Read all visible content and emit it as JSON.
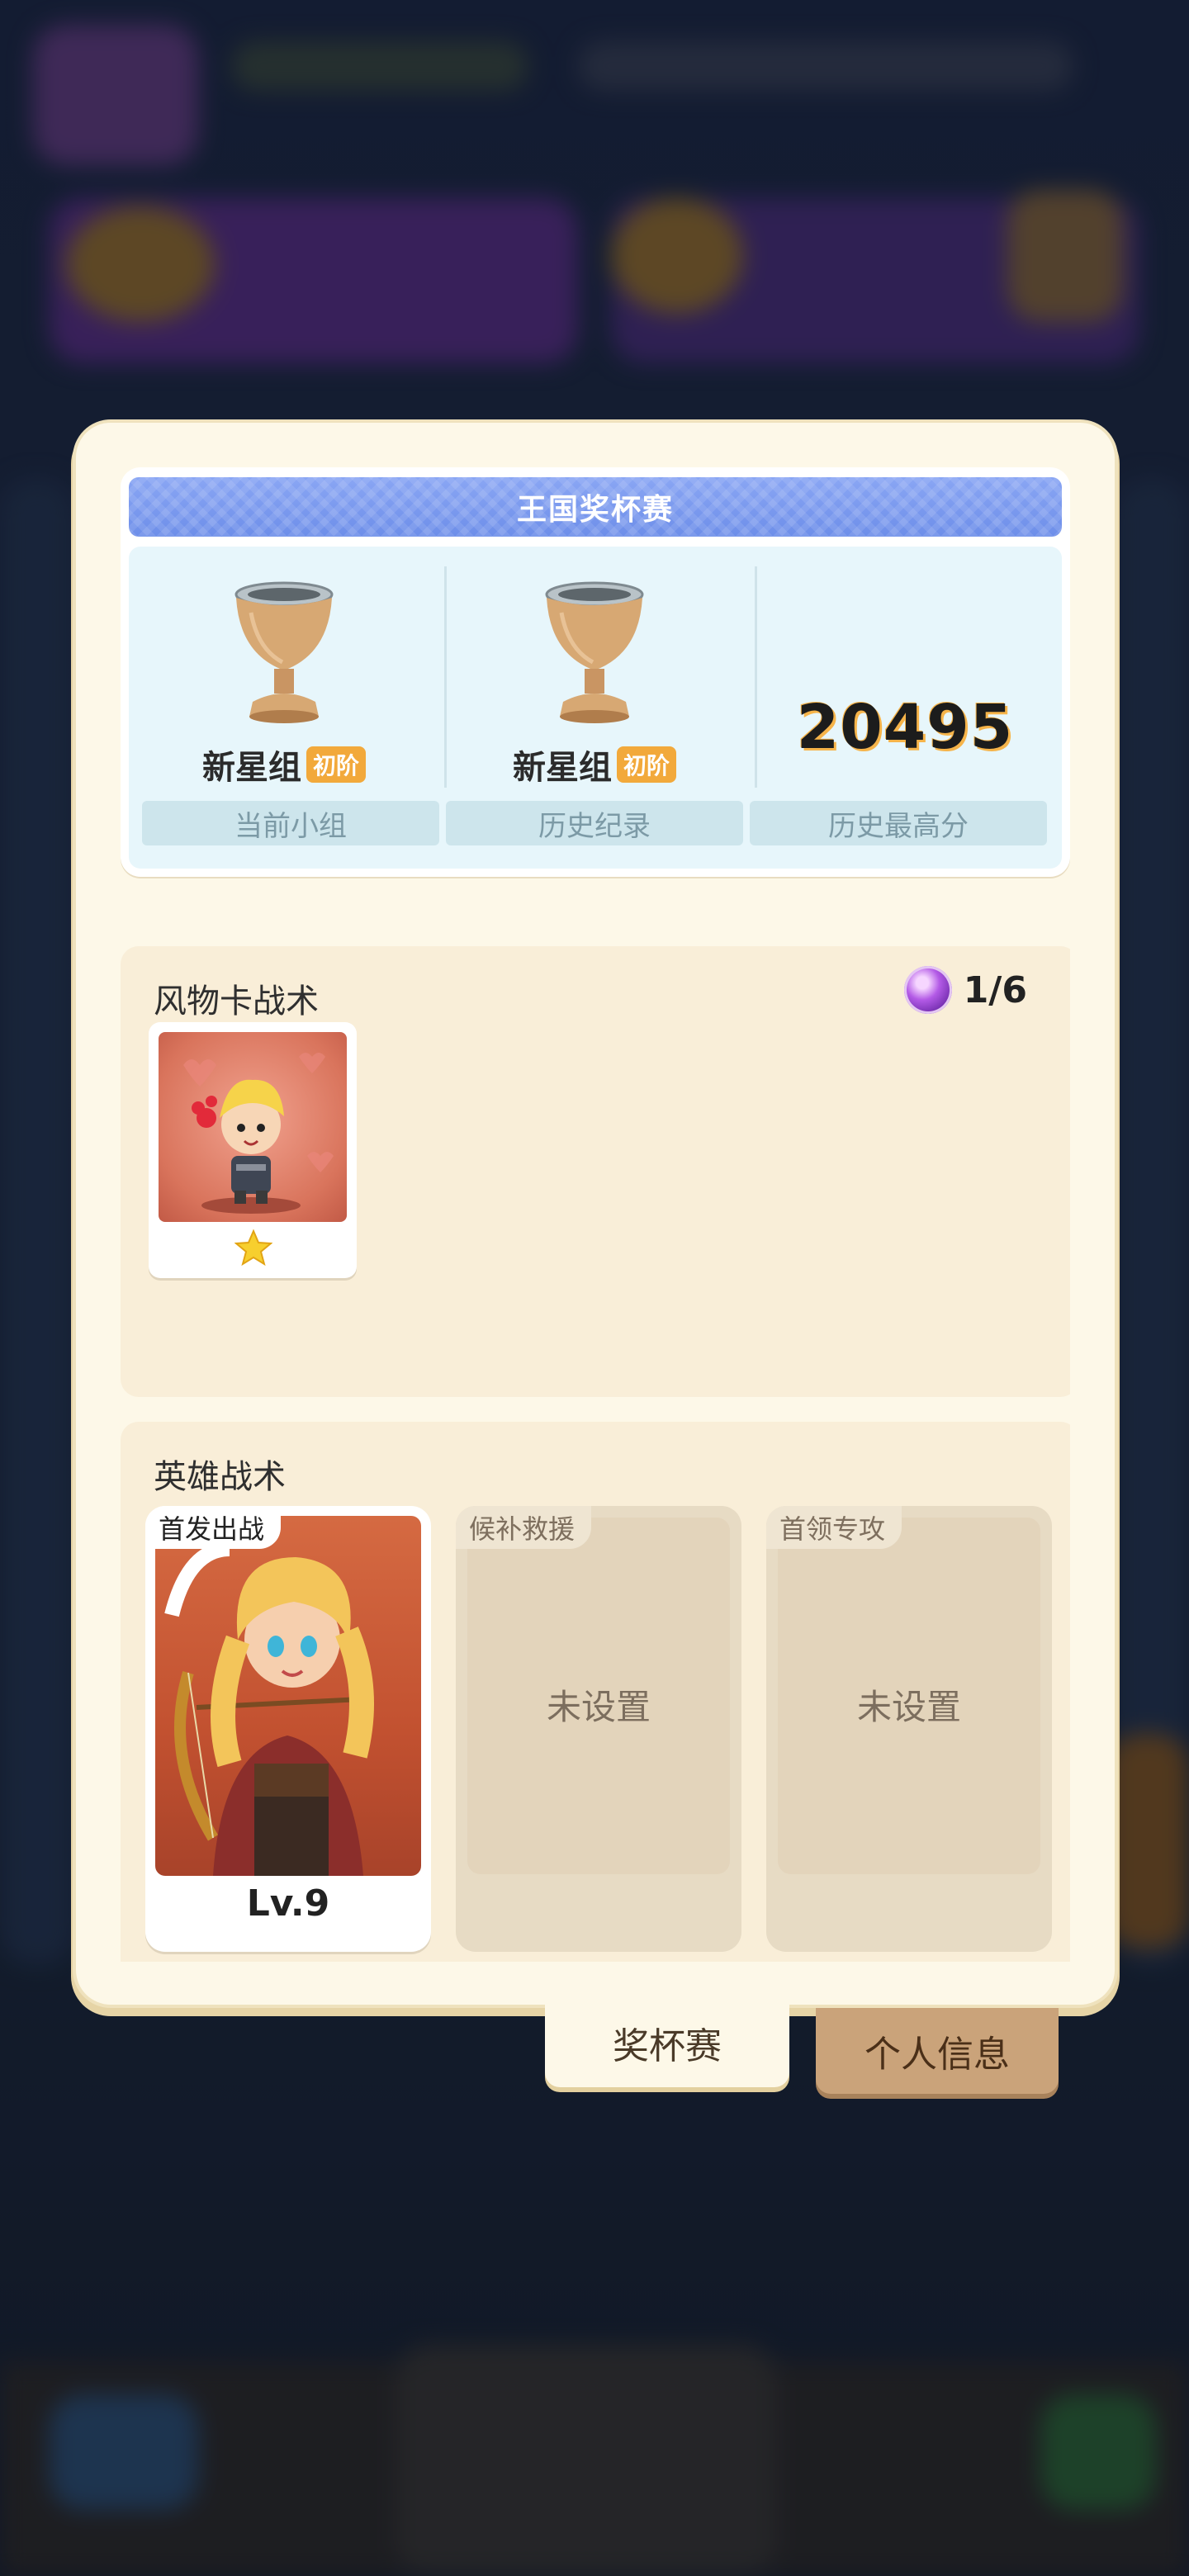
{
  "trophy_card": {
    "title": "王国奖杯赛",
    "current_group": {
      "name": "新星组",
      "rank": "初阶",
      "label": "当前小组"
    },
    "history_record": {
      "name": "新星组",
      "rank": "初阶",
      "label": "历史纪录"
    },
    "best_score": {
      "value": "20495",
      "label": "历史最高分"
    }
  },
  "card_tactics": {
    "title": "风物卡战术",
    "quota": "1/6",
    "quota_icon": "purple-orb-icon",
    "cards": [
      {
        "stars": 1,
        "star_icon": "star-icon"
      }
    ]
  },
  "hero_tactics": {
    "title": "英雄战术",
    "slots": [
      {
        "tag": "首发出战",
        "level": "Lv.9"
      },
      {
        "tag": "候补救援",
        "status": "未设置"
      },
      {
        "tag": "首领专攻",
        "status": "未设置"
      }
    ]
  },
  "tabs": {
    "trophy": "奖杯赛",
    "profile": "个人信息"
  },
  "colors": {
    "panel": "#fdf8e8",
    "title_bar": "#7c9cf0",
    "section_bg": "#f9eed8",
    "badge": "#f2a93b"
  }
}
